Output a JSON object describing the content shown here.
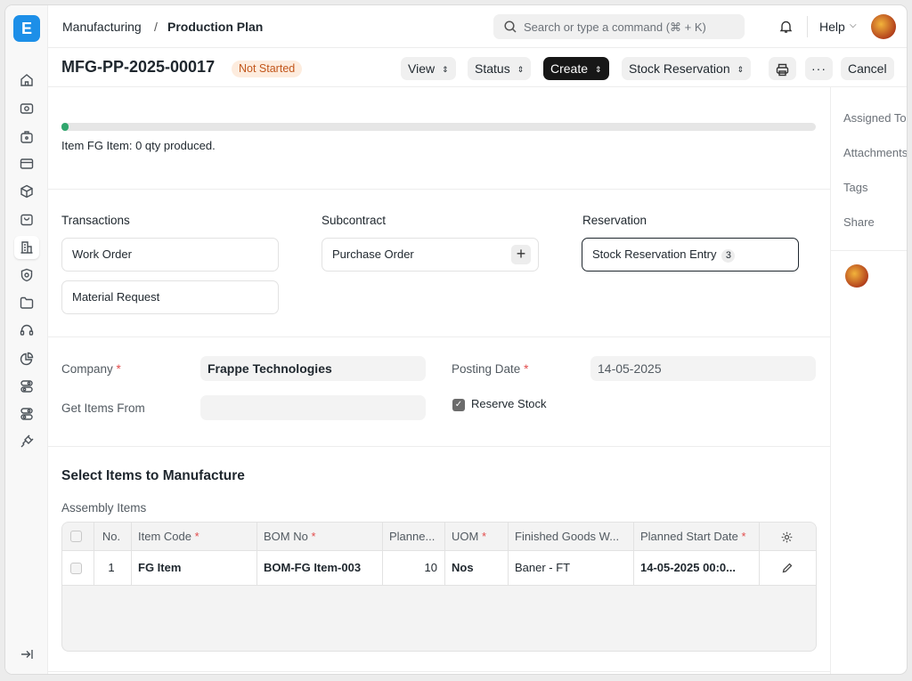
{
  "app": {
    "logo_letter": "E"
  },
  "breadcrumb": {
    "module": "Manufacturing",
    "separator": "/",
    "doctype": "Production Plan"
  },
  "search": {
    "placeholder": "Search or type a command (⌘ + K)"
  },
  "topbar": {
    "help_label": "Help"
  },
  "document": {
    "name": "MFG-PP-2025-00017",
    "status": "Not Started"
  },
  "toolbar": {
    "view": "View",
    "status": "Status",
    "create": "Create",
    "stock_reservation": "Stock Reservation",
    "more": "···",
    "cancel": "Cancel"
  },
  "progress": {
    "fraction": 0.01,
    "text": "Item FG Item: 0 qty produced."
  },
  "connections": {
    "transactions": {
      "heading": "Transactions",
      "items": [
        "Work Order",
        "Material Request"
      ]
    },
    "subcontract": {
      "heading": "Subcontract",
      "items": [
        "Purchase Order"
      ]
    },
    "reservation": {
      "heading": "Reservation",
      "item": "Stock Reservation Entry",
      "count": "3"
    }
  },
  "form": {
    "company_label": "Company",
    "company_value": "Frappe Technologies",
    "get_items_label": "Get Items From",
    "get_items_value": "",
    "posting_date_label": "Posting Date",
    "posting_date_value": "14-05-2025",
    "reserve_stock_label": "Reserve Stock",
    "reserve_stock_checked": true,
    "required_mark": "*"
  },
  "items_section": {
    "heading": "Select Items to Manufacture",
    "table_label": "Assembly Items"
  },
  "table": {
    "headers": {
      "no": "No.",
      "item_code": "Item Code",
      "bom_no": "BOM No",
      "planned_qty": "Planne...",
      "uom": "UOM",
      "warehouse": "Finished Goods W...",
      "start_date": "Planned Start Date"
    },
    "rows": [
      {
        "no": "1",
        "item_code": "FG Item",
        "bom_no": "BOM-FG Item-003",
        "planned_qty": "10",
        "uom": "Nos",
        "warehouse": "Baner - FT",
        "start_date": "14-05-2025 00:0..."
      }
    ]
  },
  "right_panel": {
    "assigned_to": "Assigned To",
    "attachments": "Attachments",
    "tags": "Tags",
    "share": "Share"
  },
  "colors": {
    "brand": "#1d8fe8",
    "status_badge_bg": "#fdecde",
    "status_badge_text": "#c2561b",
    "progress": "#30a66d"
  },
  "icons": [
    "home-icon",
    "eye-icon",
    "briefcase-icon",
    "card-icon",
    "cube-icon",
    "bag-icon",
    "building-icon",
    "shield-icon",
    "folder-icon",
    "headset-icon",
    "pie-chart-icon",
    "toggle-icon",
    "toggle-icon",
    "plug-icon",
    "collapse-sidebar-icon"
  ]
}
